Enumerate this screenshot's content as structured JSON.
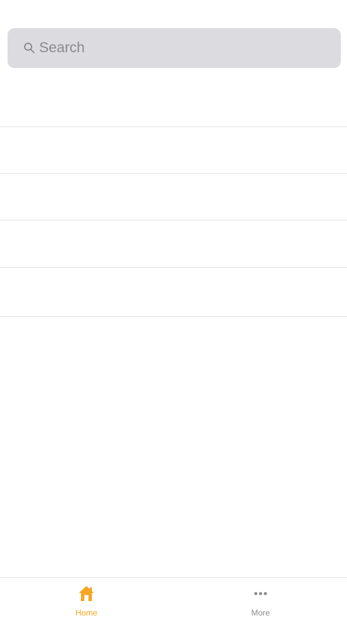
{
  "search": {
    "placeholder": "Search",
    "value": ""
  },
  "list": {
    "rows": [
      "",
      "",
      "",
      "",
      ""
    ]
  },
  "tab_bar": {
    "tabs": [
      {
        "label": "Home",
        "icon": "house-icon",
        "active": true
      },
      {
        "label": "More",
        "icon": "ellipsis-icon",
        "active": false
      }
    ],
    "active_color": "#f5a623",
    "inactive_color": "#8e8e93"
  }
}
